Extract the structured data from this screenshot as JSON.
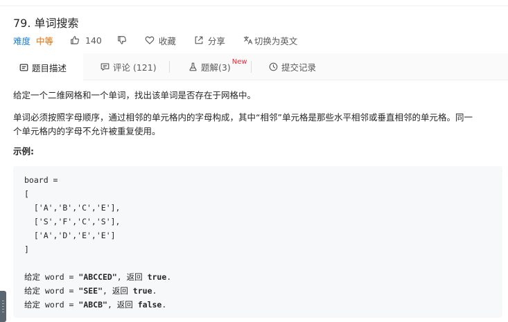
{
  "problem": {
    "title": "79. 单词搜索",
    "difficulty_label": "难度",
    "difficulty": "中等",
    "likes": "140",
    "favorite_label": "收藏",
    "share_label": "分享",
    "switch_lang_label": "切换为英文"
  },
  "tabs": [
    {
      "label": "题目描述",
      "icon": "description-icon",
      "active": true
    },
    {
      "label": "评论 (121)",
      "icon": "comment-icon",
      "active": false
    },
    {
      "label": "题解(3)",
      "icon": "flask-icon",
      "badge": "New",
      "active": false
    },
    {
      "label": "提交记录",
      "icon": "clock-icon",
      "active": false
    }
  ],
  "description": {
    "para1": "给定一个二维网格和一个单词，找出该单词是否存在于网格中。",
    "para2_line1": "单词必须按照字母顺序，通过相邻的单元格内的字母构成，其中“相邻”单元格是那些水平相邻或垂直相邻的单元格。同一",
    "para2_line2": "个单元格内的字母不允许被重复使用。",
    "example_label": "示例:"
  },
  "code": {
    "line_board": "board =",
    "line_open": "[",
    "row1": "  ['A','B','C','E'],",
    "row2": "  ['S','F','C','S'],",
    "row3": "  ['A','D','E','E']",
    "line_close": "]",
    "ex1_prefix": "给定 word = ",
    "ex1_word": "\"ABCCED\"",
    "ex1_mid": ", 返回 ",
    "ex1_result": "true",
    "ex1_end": ".",
    "ex2_prefix": "给定 word = ",
    "ex2_word": "\"SEE\"",
    "ex2_mid": ", 返回 ",
    "ex2_result": "true",
    "ex2_end": ".",
    "ex3_prefix": "给定 word = ",
    "ex3_word": "\"ABCB\"",
    "ex3_mid": ", 返回 ",
    "ex3_result": "false",
    "ex3_end": "."
  },
  "colors": {
    "link_blue": "#1a7dd6",
    "difficulty_orange": "#ef6c00",
    "badge_red": "#f5222d",
    "code_bg": "#f7f8fa"
  }
}
